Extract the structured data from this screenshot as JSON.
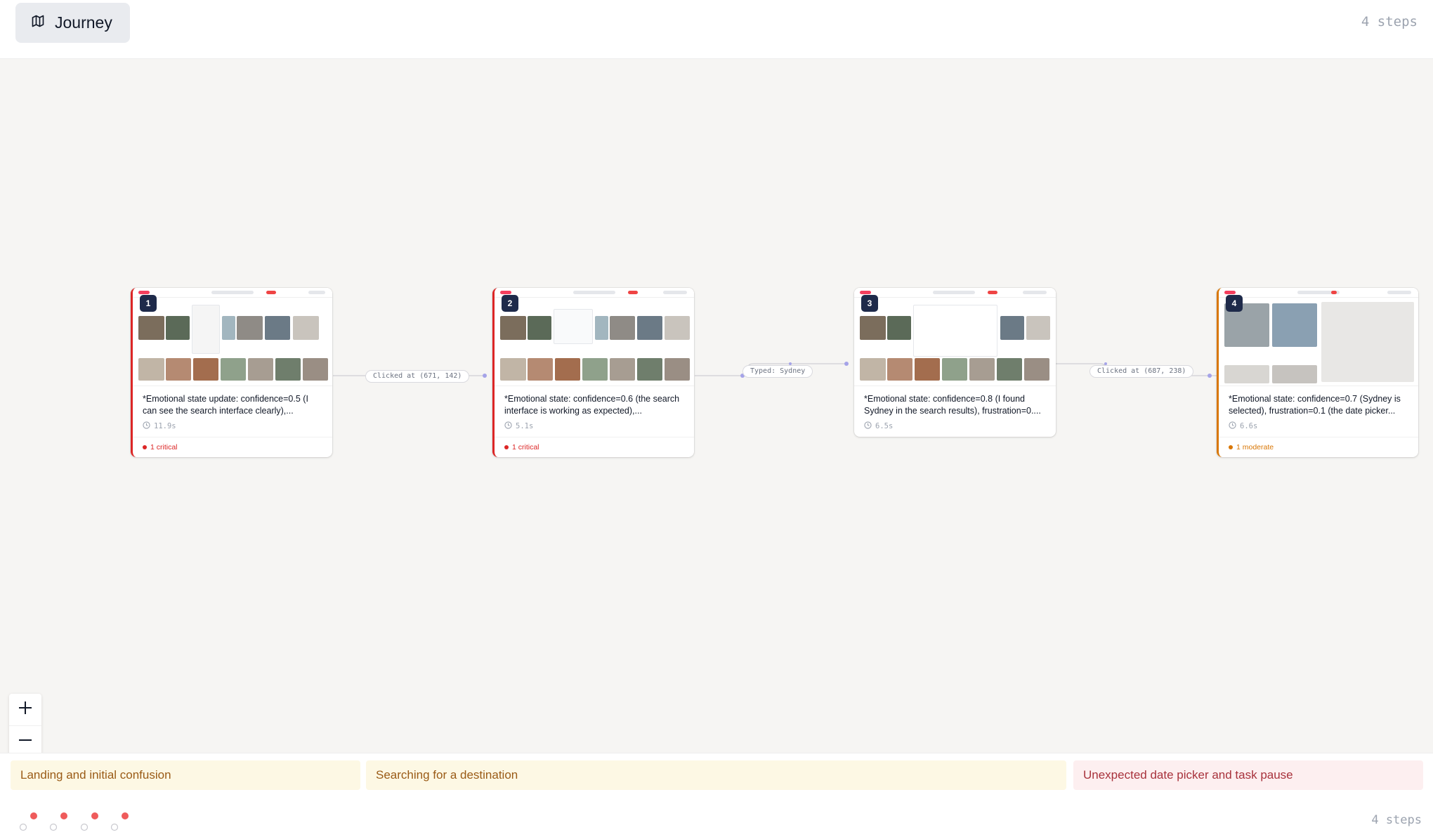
{
  "header": {
    "journey_label": "Journey",
    "journey_icon": "map-icon",
    "steps_count": "4 steps"
  },
  "edges": [
    {
      "label": "Clicked at (671, 142)"
    },
    {
      "label": "Typed: Sydney"
    },
    {
      "label": "Clicked at (687, 238)"
    }
  ],
  "steps": [
    {
      "number": "1",
      "description": "*Emotional state update: confidence=0.5 (I can see the search interface clearly),...",
      "duration": "11.9s",
      "issue": "1 critical",
      "severity": "critical"
    },
    {
      "number": "2",
      "description": "*Emotional state: confidence=0.6 (the search interface is working as expected),...",
      "duration": "5.1s",
      "issue": "1 critical",
      "severity": "critical"
    },
    {
      "number": "3",
      "description": "*Emotional state: confidence=0.8 (I found Sydney in the search results), frustration=0....",
      "duration": "6.5s",
      "issue": "",
      "severity": "none"
    },
    {
      "number": "4",
      "description": "*Emotional state: confidence=0.7 (Sydney is selected), frustration=0.1 (the date picker...",
      "duration": "6.6s",
      "issue": "1 moderate",
      "severity": "moderate"
    }
  ],
  "phases": [
    {
      "label": "Landing and initial confusion",
      "tone": "yellow"
    },
    {
      "label": "Searching for a destination",
      "tone": "yellow"
    },
    {
      "label": "Unexpected date picker and task pause",
      "tone": "pink"
    }
  ],
  "footer": {
    "steps_count": "4 steps"
  },
  "colors": {
    "critical": "#dc2626",
    "moderate": "#d97706",
    "edge": "#a5a3e8",
    "badge": "#1e2a4a"
  },
  "zoom_controls": [
    "zoom-in-icon",
    "zoom-out-icon",
    "fit-view-icon"
  ]
}
